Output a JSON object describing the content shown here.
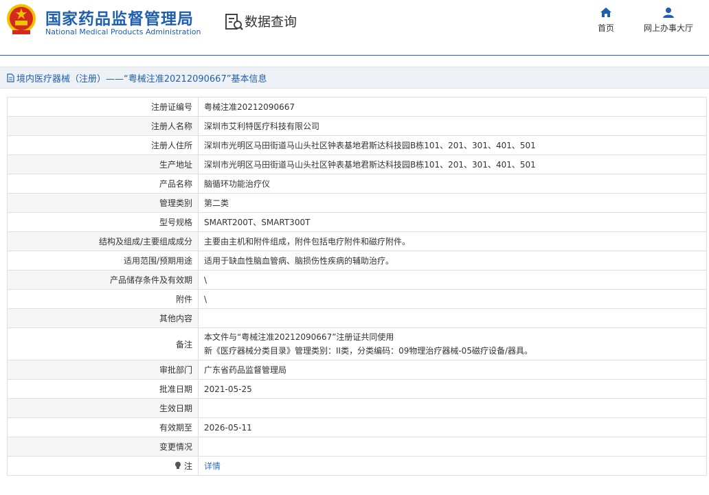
{
  "header": {
    "org_name_cn": "国家药品监督管理局",
    "org_name_en": "National Medical Products Administration",
    "section_title": "数据查询",
    "nav": {
      "home_label": "首页",
      "online_office_label": "网上办事大厅"
    }
  },
  "breadcrumb": {
    "text": "境内医疗器械（注册）——“粤械注准20212090667”基本信息"
  },
  "details": {
    "rows": [
      {
        "label": "注册证编号",
        "value": "粤械注准20212090667"
      },
      {
        "label": "注册人名称",
        "value": "深圳市艾利特医疗科技有限公司"
      },
      {
        "label": "注册人住所",
        "value": "深圳市光明区马田街道马山头社区钟表基地君斯达科技园B栋101、201、301、401、501"
      },
      {
        "label": "生产地址",
        "value": "深圳市光明区马田街道马山头社区钟表基地君斯达科技园B栋101、201、301、401、501"
      },
      {
        "label": "产品名称",
        "value": "脑循环功能治疗仪"
      },
      {
        "label": "管理类别",
        "value": "第二类"
      },
      {
        "label": "型号规格",
        "value": "SMART200T、SMART300T"
      },
      {
        "label": "结构及组成/主要组成成分",
        "value": "主要由主机和附件组成，附件包括电疗附件和磁疗附件。"
      },
      {
        "label": "适用范围/预期用途",
        "value": "适用于缺血性脑血管病、脑损伤性疾病的辅助治疗。"
      },
      {
        "label": "产品储存条件及有效期",
        "value": "\\"
      },
      {
        "label": "附件",
        "value": "\\"
      },
      {
        "label": "其他内容",
        "value": ""
      }
    ],
    "remark": {
      "label": "备注",
      "line1": "本文件与“粤械注准20212090667”注册证共同使用",
      "line2": "新《医疗器械分类目录》管理类别：II类，分类编码：09物理治疗器械-05磁疗设备/器具。"
    },
    "rows2": [
      {
        "label": "审批部门",
        "value": "广东省药品监督管理局"
      },
      {
        "label": "批准日期",
        "value": "2021-05-25"
      },
      {
        "label": "生效日期",
        "value": ""
      },
      {
        "label": "有效期至",
        "value": "2026-05-11"
      },
      {
        "label": "变更情况",
        "value": ""
      }
    ],
    "note": {
      "label": "注",
      "link": "详情"
    }
  },
  "colors": {
    "brand_blue": "#1f5fb0",
    "emblem_red": "#d42a1e",
    "emblem_gold": "#f2c200",
    "link_blue": "#2f6fc3"
  },
  "icons": [
    "national-emblem",
    "data-query-icon",
    "home-icon",
    "user-icon",
    "document-icon",
    "bulb-icon"
  ]
}
